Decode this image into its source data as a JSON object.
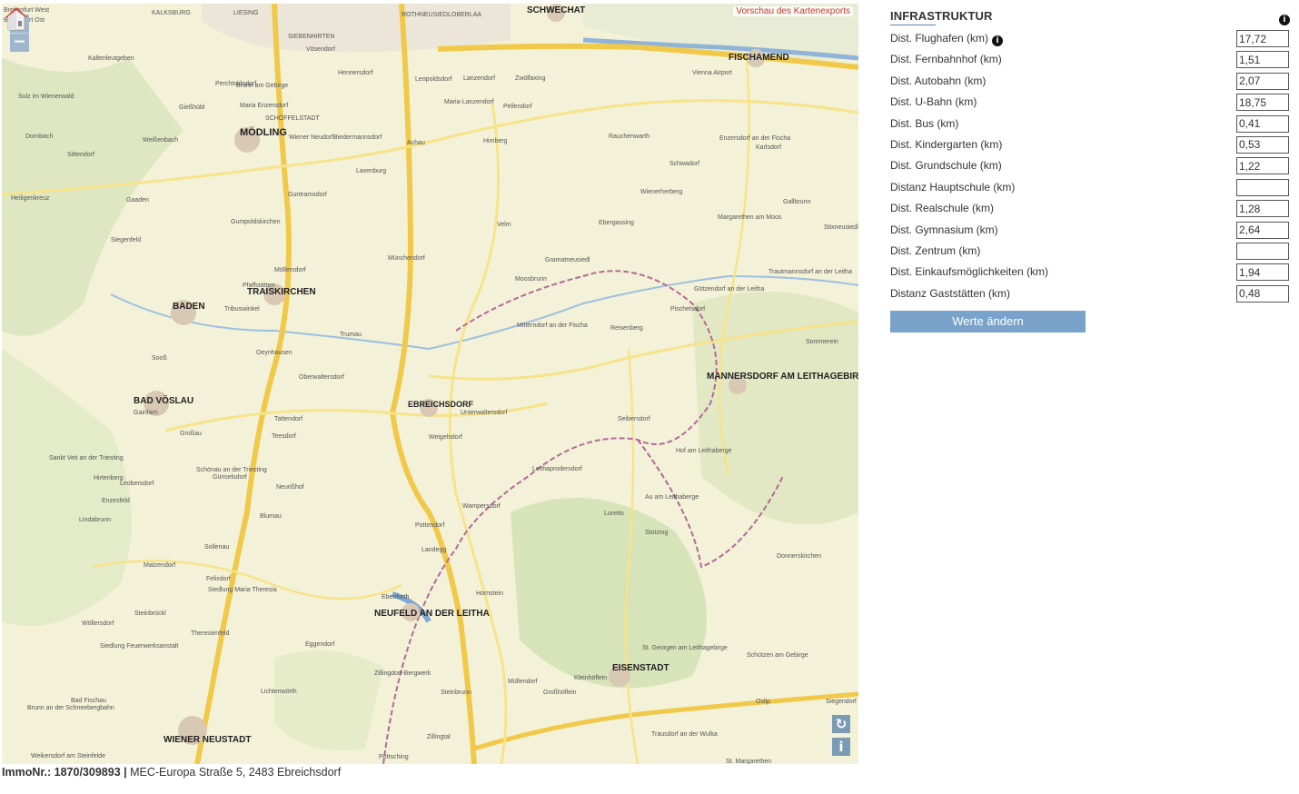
{
  "map": {
    "zoom_in": "+",
    "zoom_out": "−",
    "export_note": "Vorschau des Kartenexports",
    "refresh_glyph": "↻",
    "info_glyph": "i",
    "places": [
      "Breitenfurt West",
      "Breitenfurt Ost",
      "KALKSBURG",
      "LIESING",
      "SIEBENHIRTEN",
      "ROTHNEUSIEDL",
      "OBERLAA",
      "SCHWECHAT",
      "Kaltenleutgeben",
      "Perchtoldsdorf",
      "Vösendorf",
      "Hennersdorf",
      "Leopoldsdorf",
      "Lanzendorf",
      "Zwölfaxing",
      "FISCHAMEND",
      "Brunn am Gebirge",
      "Maria Enzersdorf",
      "SCHÖFFELSTADT",
      "Maria-Lanzendorf",
      "Pellendorf",
      "Vienna Airport",
      "Sulz im Wienerwald",
      "Gießhübl",
      "MÖDLING",
      "Wiener Neudorf",
      "Biedermannsdorf",
      "Achau",
      "Himberg",
      "Rauchenwarth",
      "Dornbach",
      "Sittendorf",
      "Weißenbach",
      "Laxenburg",
      "Enzersdorf an der Fischa",
      "Karlsdorf",
      "Schwadorf",
      "Heiligenkreuz",
      "Gaaden",
      "Guntramsdorf",
      "Gumpoldskirchen",
      "Wienerherberg",
      "Gallbrunn",
      "Velm",
      "Ebergassing",
      "Margarethen am Moos",
      "Stixneusiedl",
      "Siegenfeld",
      "Münchendorf",
      "Möllersdorf",
      "Pfaffstätten",
      "TRAISKIRCHEN",
      "Gramatneusiedl",
      "Moosbrunn",
      "Trautmannsdorf an der Leitha",
      "BADEN",
      "Tribuswinkel",
      "Götzendorf an der Leitha",
      "Pischelsdorf",
      "Mitterndorf an der Fischa",
      "Reisenberg",
      "Trumau",
      "Sommerein",
      "Oeynhausen",
      "Sooß",
      "Oberwaltersdorf",
      "MANNERSDORF AM LEITHAGEBIRGE",
      "BAD VÖSLAU",
      "Gainfarn",
      "EBREICHSDORF",
      "Unterwaltersdorf",
      "Tattendorf",
      "Seibersdorf",
      "Teesdorf",
      "Weigelsdorf",
      "Leobersdorf",
      "Hof am Leithaberge",
      "Großau",
      "Sankt Veit an der Triesting",
      "Schönau an der Triesting",
      "Leithaprodersdorf",
      "Hirtenberg",
      "Enzesfeld",
      "Günselsdorf",
      "Blumau",
      "Neurißhof",
      "Wampersdorf",
      "Au am Leithaberge",
      "Lindabrunn",
      "Loretto",
      "Stotzing",
      "Sollenau",
      "Pottendorf",
      "Landegg",
      "Donnerskirchen",
      "Matzendorf",
      "Felixdorf",
      "Siedlung Maria Theresia",
      "Hornstein",
      "Steinbrückl",
      "Theresienfeld",
      "NEUFELD AN DER LEITHA",
      "Ebenfurth",
      "Wöllersdorf",
      "Siedlung Feuerwerksanstalt",
      "Eggendorf",
      "St. Georgen am Leithagebirge",
      "Schützen am Gebirge",
      "Zillingdorf-Bergwerk",
      "EISENSTADT",
      "Müllendorf",
      "Kleinhöflein",
      "Großhöflein",
      "Steinbrunn",
      "Oslip",
      "Siegendorf",
      "Bad Fischau",
      "Brunn an der Schneebergbahn",
      "Lichtenwörth",
      "Zillingtal",
      "Trausdorf an der Wulka",
      "WIENER NEUSTADT",
      "Weikersdorf am Steinfelde",
      "Pöttsching",
      "St. Margarethen"
    ]
  },
  "footer": {
    "immo_label": "ImmoNr.: 1870/309893",
    "separator": "|",
    "address": "MEC-Europa Straße 5, 2483 Ebreichsdorf"
  },
  "panel": {
    "title": "INFRASTRUKTUR",
    "info_glyph": "i",
    "rows": [
      {
        "label": "Dist. Flughafen (km)",
        "value": "17,72",
        "has_info": true
      },
      {
        "label": "Dist. Fernbahnhof (km)",
        "value": "1,51"
      },
      {
        "label": "Dist. Autobahn (km)",
        "value": "2,07"
      },
      {
        "label": "Dist. U-Bahn (km)",
        "value": "18,75"
      },
      {
        "label": "Dist. Bus (km)",
        "value": "0,41"
      },
      {
        "label": "Dist. Kindergarten (km)",
        "value": "0,53"
      },
      {
        "label": "Dist. Grundschule (km)",
        "value": "1,22"
      },
      {
        "label": "Distanz Hauptschule (km)",
        "value": ""
      },
      {
        "label": "Dist. Realschule (km)",
        "value": "1,28"
      },
      {
        "label": "Dist. Gymnasium (km)",
        "value": "2,64"
      },
      {
        "label": "Dist. Zentrum (km)",
        "value": ""
      },
      {
        "label": "Dist. Einkaufsmöglichkeiten (km)",
        "value": "1,94"
      },
      {
        "label": "Distanz Gaststätten (km)",
        "value": "0,48"
      }
    ],
    "button_label": "Werte ändern"
  }
}
